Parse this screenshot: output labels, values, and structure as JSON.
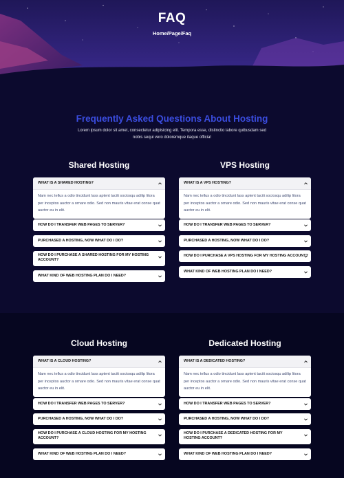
{
  "hero": {
    "title": "FAQ",
    "breadcrumb": "Home/Page/Faq"
  },
  "intro": {
    "heading": "Frequently Asked Questions About Hosting",
    "text": "Lorem ipsum dolor sit amet, consectetur adipisicing elit. Tempora esse, distinctio labore quibusdam sed nobis sequi vero doloremque itaque officia!"
  },
  "answer_text": "Nam nec tellus a odio tincidunt lass aptent taciti sociosqu adilip litora per inceptos auctor a ornare odio. Sed non mauris vitae erat conse quat auctor eu in elit.",
  "shared": {
    "title": "Shared Hosting",
    "items": [
      "WHAT IS A SHARED HOSTING?",
      "HOW DO I TRANSFER WEB PAGES TO SERVER?",
      "PURCHASED A HOSTING, NOW WHAT DO I DO?",
      "HOW DO I PURCHASE A SHARED HOSTING FOR MY HOSTING ACCOUNT?",
      "WHAT KIND OF WEB HOSTING PLAN DO I NEED?"
    ]
  },
  "vps": {
    "title": "VPS Hosting",
    "items": [
      "WHAT IS A VPS HOSTING?",
      "HOW DO I TRANSFER WEB PAGES TO SERVER?",
      "PURCHASED A HOSTING, NOW WHAT DO I DO?",
      "HOW DO I PURCHASE A VPS HOSTING FOR MY HOSTING ACCOUNT?",
      "WHAT KIND OF WEB HOSTING PLAN DO I NEED?"
    ]
  },
  "cloud": {
    "title": "Cloud Hosting",
    "items": [
      "WHAT IS A CLOUD HOSTING?",
      "HOW DO I TRANSFER WEB PAGES TO SERVER?",
      "PURCHASED A HOSTING, NOW WHAT DO I DO?",
      "HOW DO I PURCHASE A CLOUD HOSTING FOR MY HOSTING ACCOUNT?",
      "WHAT KIND OF WEB HOSTING PLAN DO I NEED?"
    ]
  },
  "dedicated": {
    "title": "Dedicated Hosting",
    "items": [
      "WHAT IS A DEDICATED HOSTING?",
      "HOW DO I TRANSFER WEB PAGES TO SERVER?",
      "PURCHASED A HOSTING, NOW WHAT DO I DO?",
      "HOW DO I PURCHASE A DEDICATED HOSTING FOR MY HOSTING ACCOUNT?",
      "WHAT KIND OF WEB HOSTING PLAN DO I NEED?"
    ]
  },
  "colors": {
    "accent": "#3b4de0",
    "background": "#0c0a2e"
  }
}
